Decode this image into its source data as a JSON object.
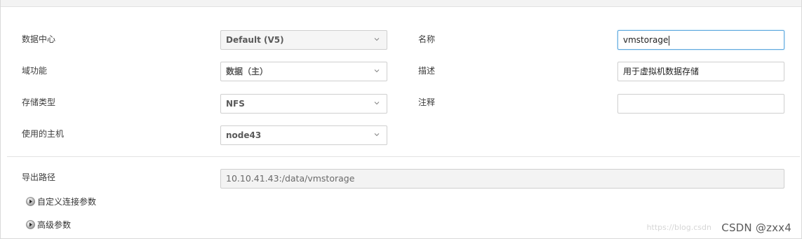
{
  "form": {
    "datacenter": {
      "label": "数据中心",
      "value": "Default (V5)"
    },
    "domain_function": {
      "label": "域功能",
      "value": "数据（主）"
    },
    "storage_type": {
      "label": "存储类型",
      "value": "NFS"
    },
    "host": {
      "label": "使用的主机",
      "value": "node43"
    },
    "name": {
      "label": "名称",
      "value": "vmstorage"
    },
    "description": {
      "label": "描述",
      "value": "用于虚拟机数据存储"
    },
    "comment": {
      "label": "注释",
      "value": ""
    },
    "export_path": {
      "label": "导出路径",
      "value": "10.10.41.43:/data/vmstorage"
    }
  },
  "expanders": {
    "custom_connection": "自定义连接参数",
    "advanced": "高级参数"
  },
  "watermark": "CSDN @zxx4",
  "watermark_faint": "https://blog.csdn"
}
